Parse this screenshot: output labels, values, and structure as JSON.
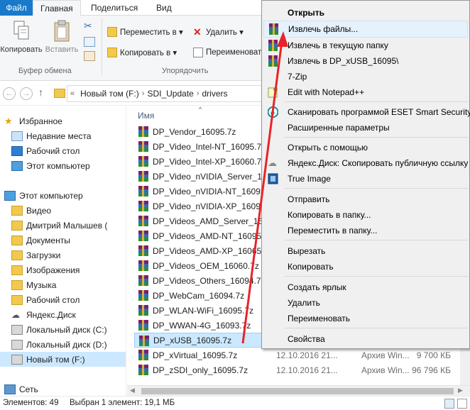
{
  "ribbon_tabs": [
    "Файл",
    "Главная",
    "Поделиться",
    "Вид"
  ],
  "ribbon": {
    "copy_label": "Копировать",
    "paste_label": "Вставить",
    "clipboard_group": "Буфер обмена",
    "move_to": "Переместить в ▾",
    "copy_to": "Копировать в ▾",
    "delete": "Удалить ▾",
    "rename": "Переименоват",
    "organize_group": "Упорядочить"
  },
  "address": {
    "chevron": "«",
    "crumbs": [
      "Новый том (F:)",
      "SDI_Update",
      "drivers"
    ]
  },
  "nav": {
    "favorites": "Избранное",
    "recent": "Недавние места",
    "desktop": "Рабочий стол",
    "this_pc_fav": "Этот компьютер",
    "this_pc": "Этот компьютер",
    "video": "Видео",
    "user": "Дмитрий Малышев (",
    "documents": "Документы",
    "downloads": "Загрузки",
    "images": "Изображения",
    "music": "Музыка",
    "desktop2": "Рабочий стол",
    "yadisk": "Яндекс.Диск",
    "disk_c": "Локальный диск (C:)",
    "disk_d": "Локальный диск (D:)",
    "disk_f": "Новый том (F:)",
    "network": "Сеть"
  },
  "filelist": {
    "col_name": "Имя",
    "sort_glyph": "^",
    "rows": [
      {
        "name": "DP_Vendor_16095.7z",
        "date": "",
        "type": "",
        "size": ""
      },
      {
        "name": "DP_Video_Intel-NT_16095.7z",
        "date": "",
        "type": "",
        "size": ""
      },
      {
        "name": "DP_Video_Intel-XP_16060.7z",
        "date": "",
        "type": "",
        "size": ""
      },
      {
        "name": "DP_Video_nVIDIA_Server_160...",
        "date": "",
        "type": "",
        "size": ""
      },
      {
        "name": "DP_Video_nVIDIA-NT_16093...",
        "date": "",
        "type": "",
        "size": ""
      },
      {
        "name": "DP_Video_nVIDIA-XP_16093.7...",
        "date": "",
        "type": "",
        "size": ""
      },
      {
        "name": "DP_Videos_AMD_Server_160...",
        "date": "",
        "type": "",
        "size": ""
      },
      {
        "name": "DP_Videos_AMD-NT_16095.7...",
        "date": "",
        "type": "",
        "size": ""
      },
      {
        "name": "DP_Videos_AMD-XP_16065.7z",
        "date": "",
        "type": "",
        "size": ""
      },
      {
        "name": "DP_Videos_OEM_16060.7z",
        "date": "",
        "type": "",
        "size": ""
      },
      {
        "name": "DP_Videos_Others_16094.7z",
        "date": "",
        "type": "",
        "size": ""
      },
      {
        "name": "DP_WebCam_16094.7z",
        "date": "",
        "type": "",
        "size": ""
      },
      {
        "name": "DP_WLAN-WiFi_16095.7z",
        "date": "",
        "type": "",
        "size": ""
      },
      {
        "name": "DP_WWAN-4G_16093.7z",
        "date": "",
        "type": "",
        "size": ""
      },
      {
        "name": "DP_xUSB_16095.7z",
        "date": "",
        "type": "",
        "size": ""
      },
      {
        "name": "DP_xVirtual_16095.7z",
        "date": "12.10.2016 21...",
        "type": "Архив Win...",
        "size": "9 700 КБ"
      },
      {
        "name": "DP_zSDI_only_16095.7z",
        "date": "12.10.2016 21...",
        "type": "Архив Win...",
        "size": "96 796 КБ"
      }
    ]
  },
  "status": {
    "items": "Элементов: 49",
    "selected": "Выбран 1 элемент: 19,1 МБ"
  },
  "context_menu": {
    "open": "Открыть",
    "extract_files": "Извлечь файлы...",
    "extract_here": "Извлечь в текущую папку",
    "extract_to": "Извлечь в DP_xUSB_16095\\",
    "seven_zip": "7-Zip",
    "notepad": "Edit with Notepad++",
    "eset": "Сканировать программой ESET Smart Security",
    "advanced": "Расширенные параметры",
    "open_with": "Открыть с помощью",
    "yadisk_copy": "Яндекс.Диск: Скопировать публичную ссылку",
    "true_image": "True Image",
    "send": "Отправить",
    "copy_to_folder": "Копировать в папку...",
    "move_to_folder": "Переместить в папку...",
    "cut": "Вырезать",
    "copy": "Копировать",
    "shortcut": "Создать ярлык",
    "delete": "Удалить",
    "rename": "Переименовать",
    "properties": "Свойства"
  },
  "colors": {
    "accent": "#1979ca",
    "selection": "#cce8ff",
    "annotation_arrow": "#e8232a"
  }
}
